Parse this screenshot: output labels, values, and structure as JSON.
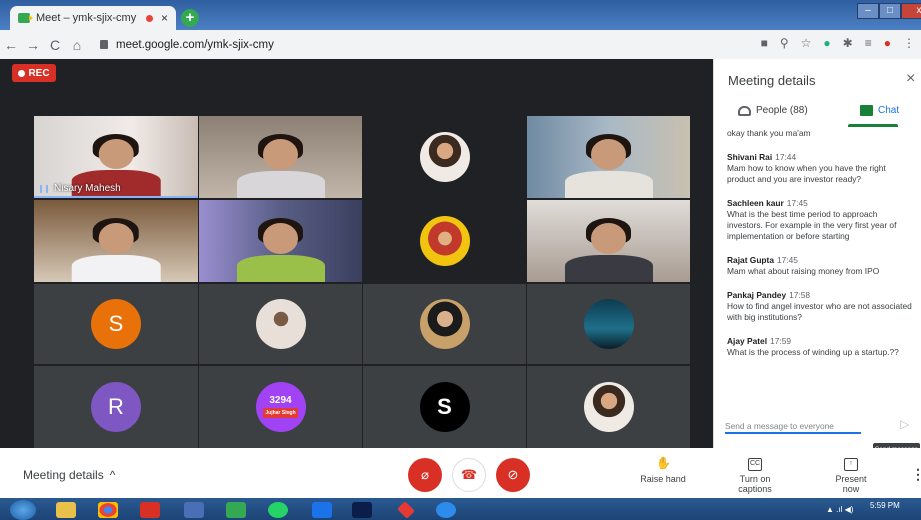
{
  "browser": {
    "tab_title": "Meet – ymk-sjix-cmy",
    "tab_close": "×",
    "new_tab": "+",
    "url": "meet.google.com/ymk-sjix-cmy",
    "back": "←",
    "forward": "→",
    "reload": "C",
    "home": "⌂"
  },
  "meet": {
    "rec_label": "REC",
    "speaker_name": "Nisary Mahesh",
    "avatars": [
      {
        "letter": "S",
        "color": "#e8710a"
      },
      {
        "letter": "R",
        "color": "#7e57c2"
      },
      {
        "letter": "S",
        "color": "#000000"
      }
    ],
    "badge_avatar": {
      "line1": "3294",
      "line2": "Jujhar Singh",
      "color": "#a142f4"
    }
  },
  "panel": {
    "title": "Meeting details",
    "close": "×",
    "people_tab": "People (88)",
    "chat_tab": "Chat",
    "messages": [
      {
        "who": "",
        "time": "",
        "text": "okay thank you ma'am"
      },
      {
        "who": "Shivani Rai",
        "time": "17:44",
        "text": "Mam how to know when you have the right product and you are investor ready?"
      },
      {
        "who": "Sachleen kaur",
        "time": "17:45",
        "text": "What is the best time period to approach investors. For example in the very first year of implementation or before starting"
      },
      {
        "who": "Rajat Gupta",
        "time": "17:45",
        "text": "Mam what about raising money from IPO"
      },
      {
        "who": "Pankaj Pandey",
        "time": "17:58",
        "text": "How to find angel investor who are not associated with big institutions?"
      },
      {
        "who": "Ajay Patel",
        "time": "17:59",
        "text": "What is the process of winding up a startup.??"
      }
    ],
    "compose_placeholder": "Send a message to everyone",
    "send_tooltip": "Send message"
  },
  "bottom": {
    "meeting_details": "Meeting details",
    "chevron": "^",
    "raise_hand": "Raise hand",
    "captions": "Turn on captions",
    "present": "Present now",
    "cc": "CC",
    "more": "⋮"
  },
  "taskbar": {
    "time": "5:59 PM"
  }
}
